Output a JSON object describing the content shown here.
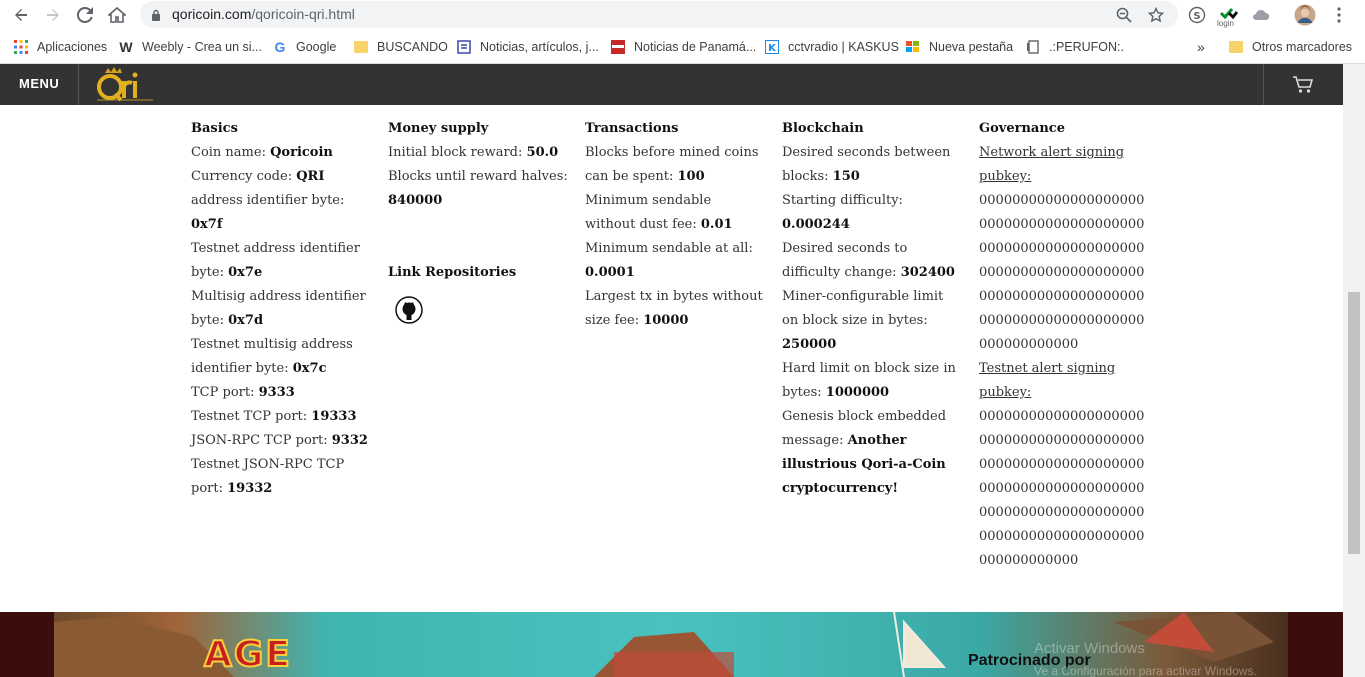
{
  "browser": {
    "url_host": "qoricoin.com",
    "url_path": "/qoricoin-qri.html",
    "ext_label": "login",
    "bookmarks": [
      {
        "label": "Aplicaciones"
      },
      {
        "label": "Weebly - Crea un si..."
      },
      {
        "label": "Google"
      },
      {
        "label": "BUSCANDO"
      },
      {
        "label": "Noticias, artículos, j..."
      },
      {
        "label": "Noticias de Panamá..."
      },
      {
        "label": "cctvradio | KASKUS"
      },
      {
        "label": "Nueva pestaña"
      },
      {
        "label": ".:PERUFON:."
      }
    ],
    "overflow": "»",
    "other_bookmarks": "Otros marcadores"
  },
  "header": {
    "menu": "MENU"
  },
  "basics": {
    "title": "Basics",
    "coin_name_label": "Coin name: ",
    "coin_name": "Qoricoin",
    "currency_label": "Currency code: ",
    "currency": "QRI",
    "addr_label": "address identifier byte: ",
    "addr": "0x7f",
    "test_addr_label": "Testnet address identifier byte: ",
    "test_addr": "0x7e",
    "multisig_label": "Multisig address identifier byte: ",
    "multisig": "0x7d",
    "test_multisig_label": "Testnet multisig address identifier byte: ",
    "test_multisig": "0x7c",
    "tcp_label": "TCP port: ",
    "tcp": "9333",
    "test_tcp_label": "Testnet TCP port: ",
    "test_tcp": "19333",
    "rpc_label": "JSON-RPC TCP port: ",
    "rpc": "9332",
    "test_rpc_label": "Testnet JSON-RPC TCP port: ",
    "test_rpc": "19332"
  },
  "money": {
    "title": "Money supply",
    "initial_label": "Initial block reward: ",
    "initial": "50.0",
    "halves_label": "Blocks until reward halves: ",
    "halves": "840000",
    "repos_title": "Link Repositories"
  },
  "transactions": {
    "title": "Transactions",
    "mined_label": "Blocks before mined coins can be spent: ",
    "mined": "100",
    "dust_label": "Minimum sendable without dust fee: ",
    "dust": "0.01",
    "min_label": "Minimum sendable at all: ",
    "min": "0.0001",
    "largest_label": "Largest tx in bytes without size fee: ",
    "largest": "10000"
  },
  "blockchain": {
    "title": "Blockchain",
    "seconds_label": "Desired seconds between blocks: ",
    "seconds": "150",
    "difficulty_label": "Starting difficulty: ",
    "difficulty": "0.000244",
    "change_label": "Desired seconds to difficulty change: ",
    "change": "302400",
    "miner_label": "Miner-configurable limit on block size in bytes: ",
    "miner": "250000",
    "hard_label": "Hard limit on block size in bytes: ",
    "hard": "1000000",
    "genesis_label": "Genesis block embedded message: ",
    "genesis": "Another illustrious Qori-a-Coin cryptocurrency!"
  },
  "governance": {
    "title": "Governance",
    "network_label": "Network alert signing pubkey:",
    "network_key": "000000000000000000000000000000000000000000000000000000000000000000000000000000000000000000000000000000000000000000000000000000000000",
    "testnet_label": "Testnet alert signing pubkey:",
    "testnet_key": "000000000000000000000000000000000000000000000000000000000000000000000000000000000000000000000000000000000000000000000000000000000000"
  },
  "banner": {
    "age": "AGE",
    "sponsor": "Patrocinado por",
    "watermark_title": "Activar Windows",
    "watermark_sub": "Ve a Configuración para activar Windows."
  }
}
